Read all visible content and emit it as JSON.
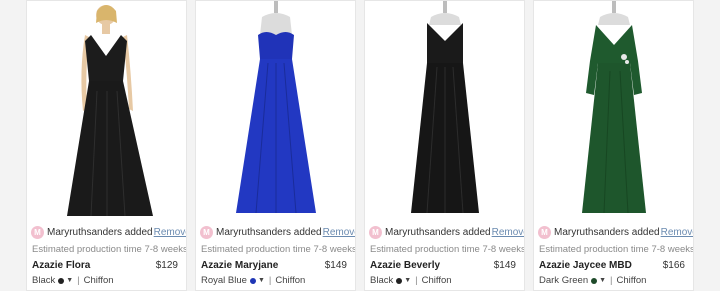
{
  "items": [
    {
      "added_by_initial": "M",
      "added_text": "Maryruthsanders added",
      "remove_label": "Remove",
      "production": "Estimated production time 7-8 weeks",
      "name": "Azazie Flora",
      "price": "$129",
      "color": "Black",
      "color_hex": "#222222",
      "fabric": "Chiffon",
      "dress_color": "#1c1c1c"
    },
    {
      "added_by_initial": "M",
      "added_text": "Maryruthsanders added",
      "remove_label": "Remove",
      "production": "Estimated production time 7-8 weeks",
      "name": "Azazie Maryjane",
      "price": "$149",
      "color": "Royal Blue",
      "color_hex": "#1f36b5",
      "fabric": "Chiffon",
      "dress_color": "#2033b8"
    },
    {
      "added_by_initial": "M",
      "added_text": "Maryruthsanders added",
      "remove_label": "Remove",
      "production": "Estimated production time 7-8 weeks",
      "name": "Azazie Beverly",
      "price": "$149",
      "color": "Black",
      "color_hex": "#222222",
      "fabric": "Chiffon",
      "dress_color": "#1a1a1a"
    },
    {
      "added_by_initial": "M",
      "added_text": "Maryruthsanders added",
      "remove_label": "Remove",
      "production": "Estimated production time 7-8 weeks",
      "name": "Azazie Jaycee MBD",
      "price": "$166",
      "color": "Dark Green",
      "color_hex": "#1e4a2a",
      "fabric": "Chiffon",
      "dress_color": "#1f5a2e"
    }
  ],
  "separator": "|",
  "caret_icon": "▼"
}
